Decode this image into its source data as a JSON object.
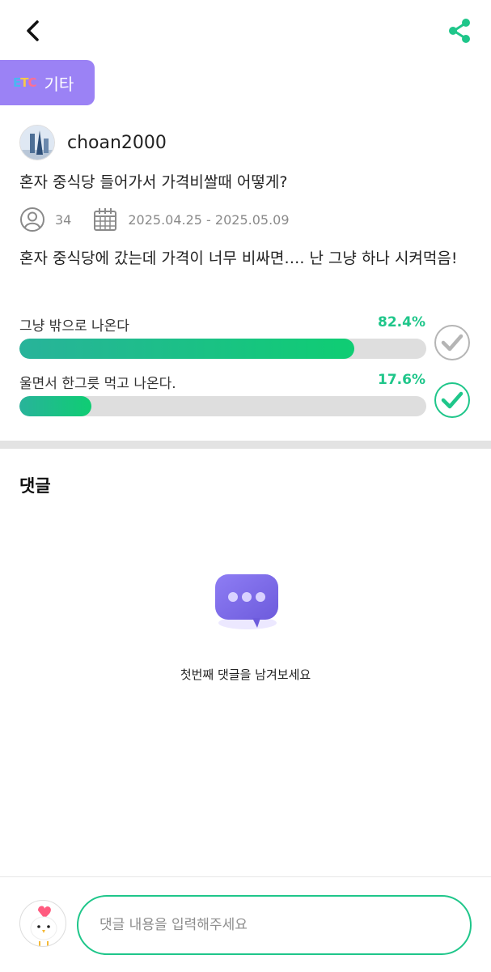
{
  "header": {
    "back_icon": "chevron-left-icon",
    "share_icon": "share-icon",
    "accent_color": "#1fc68a"
  },
  "category": {
    "logo_text_e": "E",
    "logo_text_t": "T",
    "logo_text_c": "C",
    "label": "기타",
    "color": "#9b82f5"
  },
  "post": {
    "author": "choan2000",
    "title": "혼자 중식당 들어가서 가격비쌀때 어떻게?",
    "participants": "34",
    "date_range": "2025.04.25 - 2025.05.09",
    "body": "혼자 중식당에 갔는데 가격이 너무 비싸면…. 난 그냥 하나 시켜먹음!"
  },
  "poll": {
    "options": [
      {
        "label": "그냥 밖으로 나온다",
        "percent_text": "82.4%",
        "fraction": 0.824,
        "selected": false
      },
      {
        "label": "울면서 한그릇 먹고 나온다.",
        "percent_text": "17.6%",
        "fraction": 0.176,
        "selected": true
      }
    ]
  },
  "comments": {
    "title": "댓글",
    "empty_text": "첫번째 댓글을 남겨보세요",
    "input_placeholder": "댓글 내용을 입력해주세요"
  }
}
